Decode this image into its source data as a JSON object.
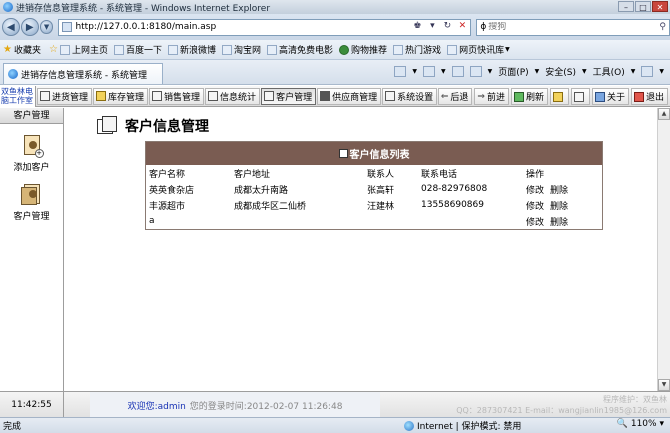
{
  "browser": {
    "window_title": "进销存信息管理系统 - 系统管理 - Windows Internet Explorer",
    "url": "http://127.0.0.1:8180/main.asp",
    "search_placeholder": "搜狗",
    "favorites_label": "收藏夹",
    "favorites": [
      "上网主页",
      "百度一下",
      "新浪微博",
      "淘宝网",
      "高清免费电影",
      "购物推荐",
      "热门游戏",
      "网页快讯库"
    ],
    "tab_title": "进销存信息管理系统 - 系统管理",
    "commands": [
      "页面(P)",
      "安全(S)",
      "工具(O)"
    ],
    "status_done": "完成",
    "zone": "Internet | 保护模式: 禁用",
    "zoom": "110%"
  },
  "app": {
    "brand": "双鱼林电脑工作室",
    "toolbar": [
      "进货管理",
      "库存管理",
      "销售管理",
      "信息统计",
      "客户管理",
      "供应商管理",
      "系统设置"
    ],
    "toolbar_right": [
      "后退",
      "前进",
      "刷新",
      "关于",
      "退出"
    ],
    "sidebar": {
      "header": "客户管理",
      "items": [
        "添加客户",
        "客户管理"
      ]
    },
    "page_title": "客户信息管理",
    "table": {
      "title": "客户信息列表",
      "headers": [
        "客户名称",
        "客户地址",
        "联系人",
        "联系电话",
        "操作"
      ],
      "rows": [
        {
          "name": "英英食杂店",
          "address": "成都太升南路",
          "contact": "张高轩",
          "phone": "028-82976808"
        },
        {
          "name": "丰源超市",
          "address": "成都成华区二仙桥",
          "contact": "汪建林",
          "phone": "13558690869"
        },
        {
          "name": "a",
          "address": "",
          "contact": "",
          "phone": ""
        }
      ],
      "edit_label": "修改",
      "delete_label": "删除"
    },
    "footer": {
      "clock": "11:42:55",
      "welcome": "欢迎您:admin",
      "login_time": "您的登录时间:2012-02-07 11:26:48",
      "support_line1": "程序维护：双鱼林",
      "support_line2": "QQ：287307421 E-mail：wangjianlin1985@126.com"
    }
  }
}
